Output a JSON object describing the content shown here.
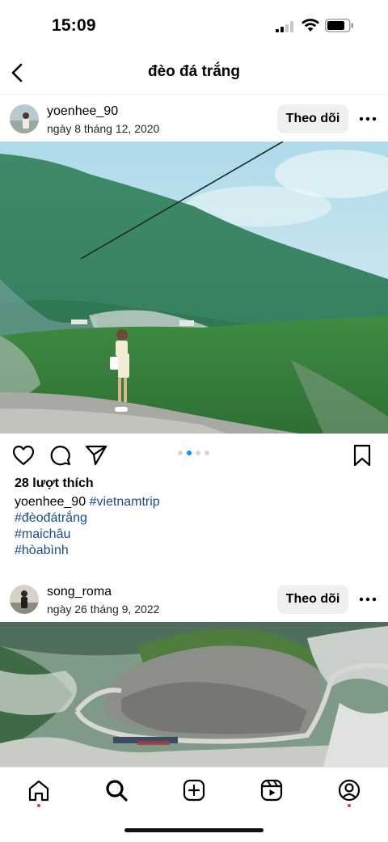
{
  "status_bar": {
    "time": "15:09"
  },
  "header": {
    "title": "đèo đá trắng"
  },
  "posts": [
    {
      "username": "yoenhee_90",
      "date": "ngày 8 tháng 12, 2020",
      "follow_label": "Theo dõi",
      "likes": "28 lượt thích",
      "caption_user": "yoenhee_90",
      "hashtags": [
        "#vietnamtrip",
        "#đèođátrắng",
        "#maichâu",
        "#hòabình"
      ],
      "carousel_total": 4,
      "carousel_active": 2
    },
    {
      "username": "song_roma",
      "date": "ngày 26 tháng 9, 2022",
      "follow_label": "Theo dõi"
    }
  ],
  "bottom_nav": [
    "home-icon",
    "search-icon",
    "create-post-icon",
    "reels-icon",
    "profile-icon"
  ],
  "colors": {
    "hashtag": "#1b4a8c",
    "notification_dot": "#ed2b47",
    "follow_bg": "#efefef"
  }
}
